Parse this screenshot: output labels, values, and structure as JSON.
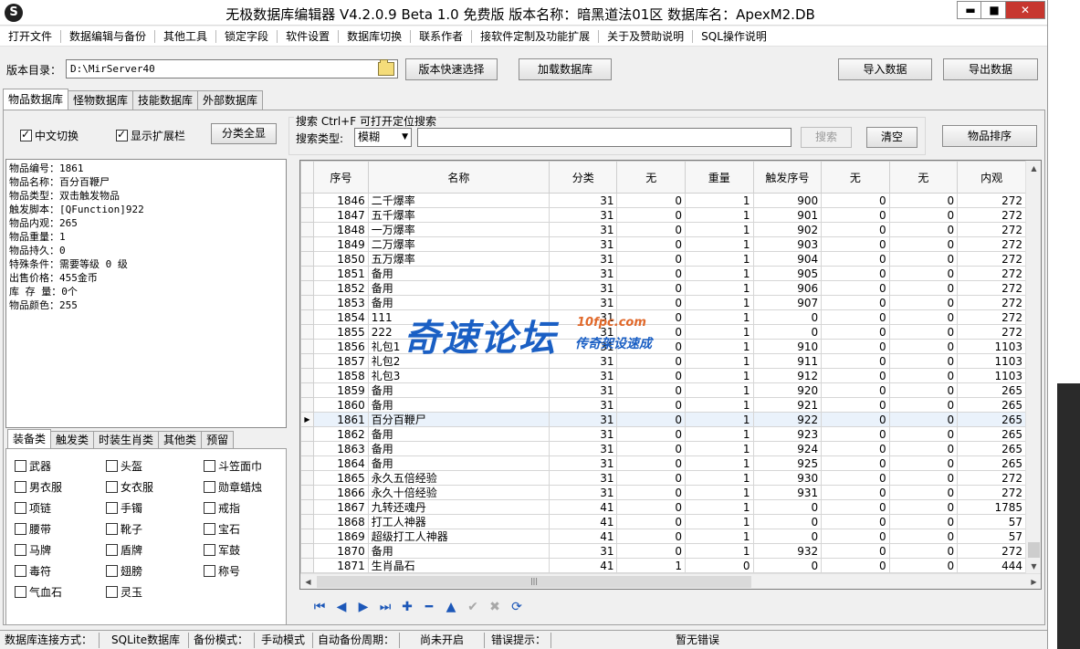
{
  "window": {
    "app_icon": "S",
    "title": "无极数据库编辑器 V4.2.0.9    Beta 1.0 免费版    版本名称：暗黑道法01区    数据库名：ApexM2.DB",
    "minimize": "▬",
    "maximize": "■",
    "close": "✕"
  },
  "menu": [
    "打开文件",
    "数据编辑与备份",
    "其他工具",
    "锁定字段",
    "软件设置",
    "数据库切换",
    "联系作者",
    "接软件定制及功能扩展",
    "关于及赞助说明",
    "SQL操作说明"
  ],
  "directory": {
    "label": "版本目录：",
    "value": "D:\\MirServer40",
    "quick_select": "版本快速选择",
    "load_db": "加载数据库",
    "import": "导入数据",
    "export": "导出数据"
  },
  "top_tabs": [
    "物品数据库",
    "怪物数据库",
    "技能数据库",
    "外部数据库"
  ],
  "options": {
    "chinese_switch": "中文切换",
    "chinese_switch_checked": true,
    "show_ext": "显示扩展栏",
    "show_ext_checked": true,
    "show_all_categories": "分类全显"
  },
  "search": {
    "title": "搜索  Ctrl+F 可打开定位搜索",
    "type_label": "搜索类型:",
    "type_value": "模糊",
    "query": "",
    "search_button": "搜索",
    "clear_button": "清空",
    "sort_button": "物品排序"
  },
  "item_info": [
    "物品编号：1861",
    "物品名称：百分百鞭尸",
    "物品类型：双击触发物品",
    "触发脚本：[QFunction]922",
    "物品内观：265",
    "物品重量：1",
    "物品持久：0",
    "特殊条件：需要等级 0 级",
    "出售价格：455金币",
    "库 存 量：0个",
    "物品颜色：255"
  ],
  "category_tabs": [
    "装备类",
    "触发类",
    "时装生肖类",
    "其他类",
    "预留"
  ],
  "categories": [
    "武器",
    "头盔",
    "斗笠面巾",
    "男衣服",
    "女衣服",
    "勋章蜡烛",
    "项链",
    "手镯",
    "戒指",
    "腰带",
    "靴子",
    "宝石",
    "马牌",
    "盾牌",
    "军鼓",
    "毒符",
    "翅膀",
    "称号",
    "气血石",
    "灵玉"
  ],
  "grid": {
    "columns": [
      "序号",
      "名称",
      "分类",
      "无",
      "重量",
      "触发序号",
      "无",
      "无",
      "内观"
    ],
    "rows": [
      [
        "1846",
        "二千爆率",
        "31",
        "0",
        "1",
        "900",
        "0",
        "0",
        "272"
      ],
      [
        "1847",
        "五千爆率",
        "31",
        "0",
        "1",
        "901",
        "0",
        "0",
        "272"
      ],
      [
        "1848",
        "一万爆率",
        "31",
        "0",
        "1",
        "902",
        "0",
        "0",
        "272"
      ],
      [
        "1849",
        "二万爆率",
        "31",
        "0",
        "1",
        "903",
        "0",
        "0",
        "272"
      ],
      [
        "1850",
        "五万爆率",
        "31",
        "0",
        "1",
        "904",
        "0",
        "0",
        "272"
      ],
      [
        "1851",
        "备用",
        "31",
        "0",
        "1",
        "905",
        "0",
        "0",
        "272"
      ],
      [
        "1852",
        "备用",
        "31",
        "0",
        "1",
        "906",
        "0",
        "0",
        "272"
      ],
      [
        "1853",
        "备用",
        "31",
        "0",
        "1",
        "907",
        "0",
        "0",
        "272"
      ],
      [
        "1854",
        "111",
        "31",
        "0",
        "1",
        "0",
        "0",
        "0",
        "272"
      ],
      [
        "1855",
        "222",
        "31",
        "0",
        "1",
        "0",
        "0",
        "0",
        "272"
      ],
      [
        "1856",
        "礼包1",
        "31",
        "0",
        "1",
        "910",
        "0",
        "0",
        "1103"
      ],
      [
        "1857",
        "礼包2",
        "31",
        "0",
        "1",
        "911",
        "0",
        "0",
        "1103"
      ],
      [
        "1858",
        "礼包3",
        "31",
        "0",
        "1",
        "912",
        "0",
        "0",
        "1103"
      ],
      [
        "1859",
        "备用",
        "31",
        "0",
        "1",
        "920",
        "0",
        "0",
        "265"
      ],
      [
        "1860",
        "备用",
        "31",
        "0",
        "1",
        "921",
        "0",
        "0",
        "265"
      ],
      [
        "1861",
        "百分百鞭尸",
        "31",
        "0",
        "1",
        "922",
        "0",
        "0",
        "265"
      ],
      [
        "1862",
        "备用",
        "31",
        "0",
        "1",
        "923",
        "0",
        "0",
        "265"
      ],
      [
        "1863",
        "备用",
        "31",
        "0",
        "1",
        "924",
        "0",
        "0",
        "265"
      ],
      [
        "1864",
        "备用",
        "31",
        "0",
        "1",
        "925",
        "0",
        "0",
        "265"
      ],
      [
        "1865",
        "永久五倍经验",
        "31",
        "0",
        "1",
        "930",
        "0",
        "0",
        "272"
      ],
      [
        "1866",
        "永久十倍经验",
        "31",
        "0",
        "1",
        "931",
        "0",
        "0",
        "272"
      ],
      [
        "1867",
        "九转还魂丹",
        "41",
        "0",
        "1",
        "0",
        "0",
        "0",
        "1785"
      ],
      [
        "1868",
        "打工人神器",
        "41",
        "0",
        "1",
        "0",
        "0",
        "0",
        "57"
      ],
      [
        "1869",
        "超级打工人神器",
        "41",
        "0",
        "1",
        "0",
        "0",
        "0",
        "57"
      ],
      [
        "1870",
        "备用",
        "31",
        "0",
        "1",
        "932",
        "0",
        "0",
        "272"
      ],
      [
        "1871",
        "生肖晶石",
        "41",
        "1",
        "0",
        "0",
        "0",
        "0",
        "444"
      ]
    ],
    "selected_row": 15,
    "row_indicator": "▶"
  },
  "navigator": [
    {
      "icon": "first-icon",
      "glyph": "⏮",
      "enabled": true
    },
    {
      "icon": "prior-icon",
      "glyph": "◀",
      "enabled": true
    },
    {
      "icon": "next-icon",
      "glyph": "▶",
      "enabled": true
    },
    {
      "icon": "last-icon",
      "glyph": "⏭",
      "enabled": true
    },
    {
      "icon": "insert-icon",
      "glyph": "✚",
      "enabled": true
    },
    {
      "icon": "delete-icon",
      "glyph": "━",
      "enabled": true
    },
    {
      "icon": "edit-icon",
      "glyph": "▲",
      "enabled": true
    },
    {
      "icon": "post-icon",
      "glyph": "✔",
      "enabled": false
    },
    {
      "icon": "cancel-icon",
      "glyph": "✖",
      "enabled": false
    },
    {
      "icon": "refresh-icon",
      "glyph": "⟳",
      "enabled": true
    }
  ],
  "watermark": {
    "main": "奇速论坛",
    "url": "10fpc.com",
    "sub": "传奇架设速成"
  },
  "status": {
    "conn_label": "数据库连接方式：",
    "conn_value": "SQLite数据库",
    "backup_label": "备份模式：",
    "backup_value": "手动模式",
    "auto_label": "自动备份周期：",
    "auto_value": "尚未开启",
    "error_label": "错误提示：",
    "error_value": "暂无错误"
  },
  "colors": {
    "accent": "#1c57b8",
    "close": "#c7372f",
    "selected_row": "#eaf2fb"
  }
}
